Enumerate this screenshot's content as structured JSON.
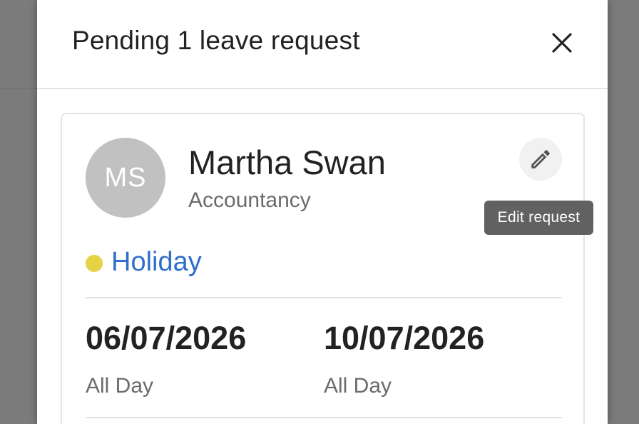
{
  "dialog": {
    "title": "Pending 1 leave request",
    "close_icon": "close-icon"
  },
  "request": {
    "avatar_initials": "MS",
    "name": "Martha Swan",
    "department": "Accountancy",
    "edit_icon": "pencil-icon",
    "edit_tooltip": "Edit request",
    "leave_type": "Holiday",
    "leave_color": "#e5d245",
    "leave_text_color": "#2f6fcb",
    "start_date": "06/07/2026",
    "start_time": "All Day",
    "end_date": "10/07/2026",
    "end_time": "All Day"
  }
}
